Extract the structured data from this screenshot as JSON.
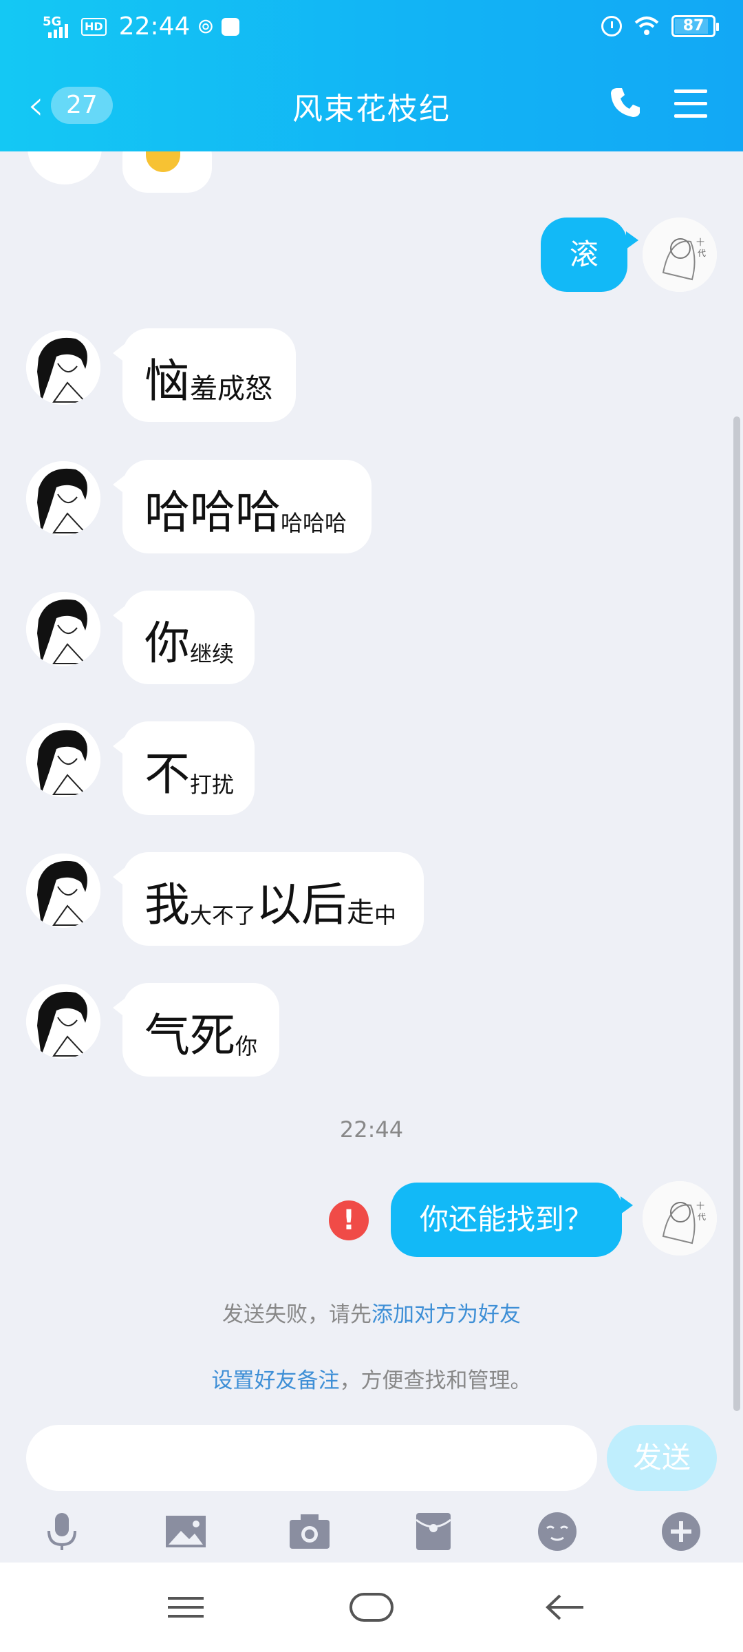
{
  "status_bar": {
    "network": "5G",
    "hd": "HD",
    "time": "22:44",
    "battery": "87"
  },
  "header": {
    "back_badge": "27",
    "title": "风束花枝纪"
  },
  "messages": {
    "m1": "滚",
    "m2_big": "恼",
    "m2_small": "羞成怒",
    "m3_big": "哈哈哈",
    "m3_small": "哈哈哈",
    "m4_big": "你",
    "m4_small": "继续",
    "m5_big": "不",
    "m5_small": "打扰",
    "m6_a": "我",
    "m6_b": "大不了",
    "m6_c": "以后",
    "m6_d": "走",
    "m6_e": "中",
    "m7_big": "气死",
    "m7_small": "你",
    "timestamp": "22:44",
    "m8": "你还能找到？",
    "fail_mark": "!"
  },
  "system_notes": {
    "line1_text": "发送失败，请先",
    "line1_link": "添加对方为好友",
    "line2_link": "设置好友备注",
    "line2_text": "，方便查找和管理。"
  },
  "input": {
    "placeholder": "",
    "send_label": "发送"
  },
  "icons": {
    "toolbar": [
      "microphone-icon",
      "image-icon",
      "camera-icon",
      "red-packet-icon",
      "emoji-icon",
      "plus-icon"
    ],
    "nav": [
      "menu-icon",
      "home-icon",
      "back-icon"
    ]
  },
  "colors": {
    "header_gradient_start": "#14c8f4",
    "header_gradient_end": "#12a8f5",
    "outgoing_bubble": "#12b9f7",
    "background": "#eef0f6",
    "link": "#3e8fd6",
    "error": "#f04b47",
    "send_disabled": "#bfeefd"
  }
}
